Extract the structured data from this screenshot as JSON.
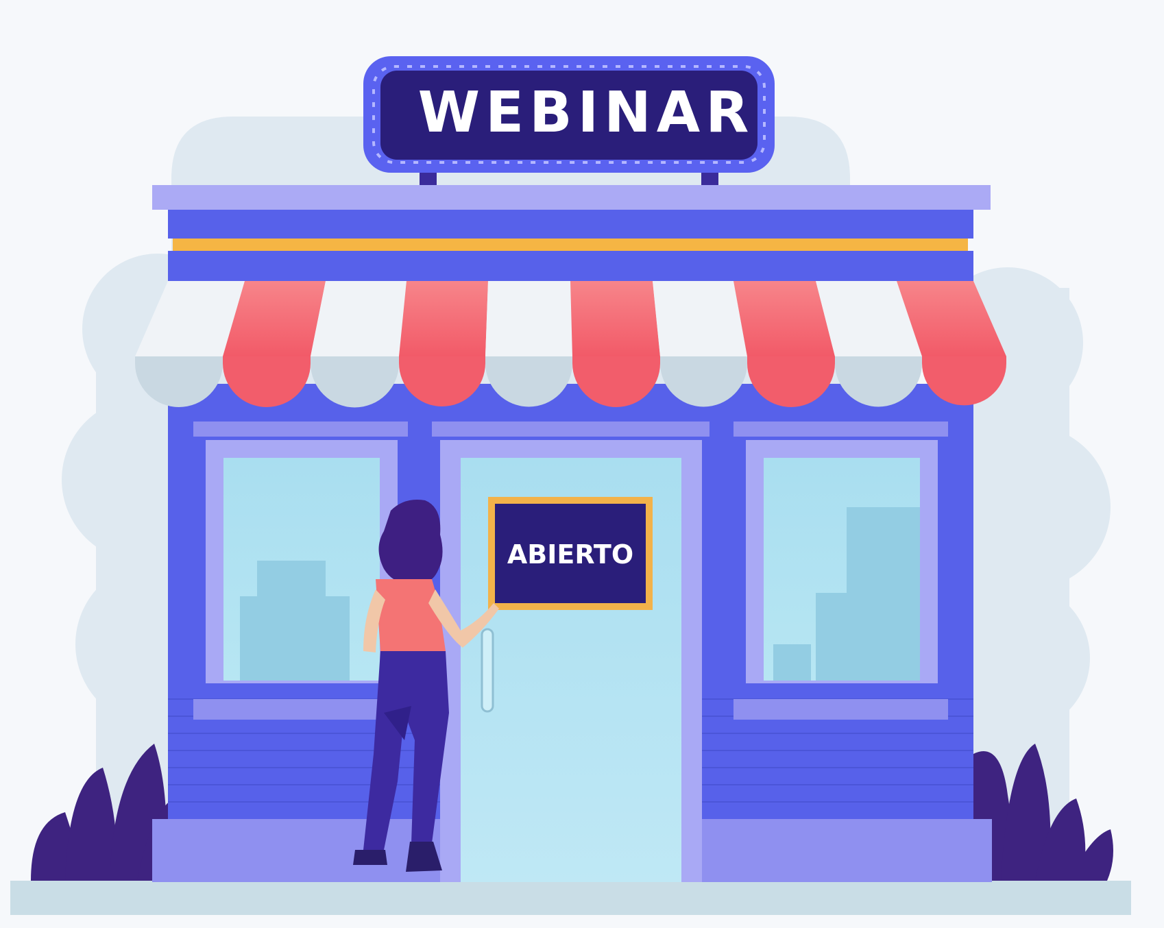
{
  "sign": {
    "title": "WEBINAR"
  },
  "door_sign": {
    "text": "ABIERTO"
  },
  "colors": {
    "background": "#f6f8fb",
    "cloud": "#dde8f0",
    "wall": "#5561ea",
    "trim": "#a9a9f5",
    "frame": "#8e8ef0",
    "glass": "#a6dcec",
    "sign_bg": "#2a1e7a",
    "sign_border": "#5a62f0",
    "awning_red": "#f26f78",
    "awning_white": "#f0f3f7",
    "accent_yellow": "#f5b544",
    "plant": "#3c1f7a",
    "ground": "#c8dde6"
  }
}
